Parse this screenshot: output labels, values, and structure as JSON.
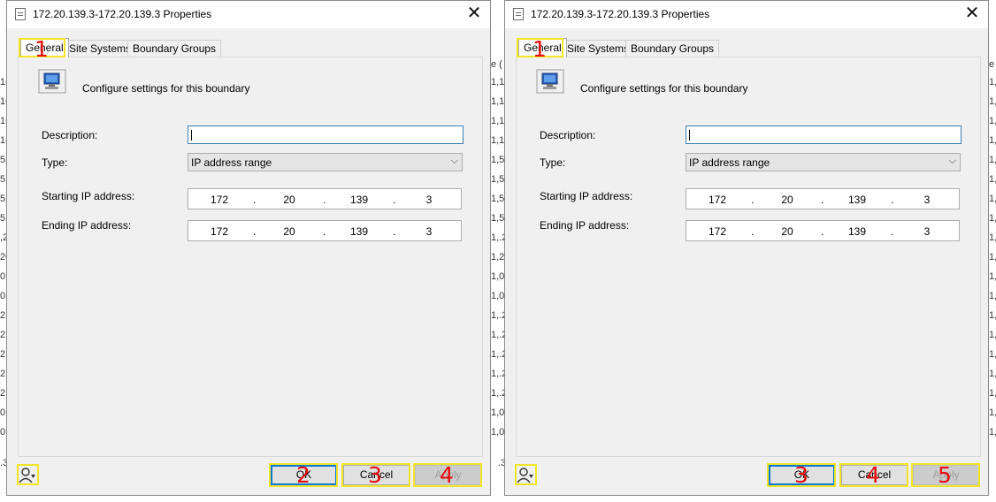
{
  "background": {
    "left_strip_chars": [
      "16",
      "16",
      "16",
      "16",
      "5.",
      "5.",
      "5.",
      "5.",
      ",2",
      "20",
      "0.",
      "0.",
      "2.",
      "2.",
      "2.",
      "2.",
      "2.",
      "0.",
      "0."
    ],
    "middle_strip_chars": [
      "1,16",
      "1,16",
      "1,16",
      "1,16",
      "1,5.",
      "1,5.",
      "1,5.",
      "1,5.",
      "1,.2",
      "1,20",
      "1,0.",
      "1,0.",
      "1,.2",
      "1,.2",
      "1,.2",
      "1,.2",
      "1,.2",
      "1,0.",
      "1,0."
    ],
    "middle_top_char": "e (",
    "right_top_char": "e (",
    "right_strip_chars": [
      "1,",
      "1,",
      "1,",
      "1,",
      "1,",
      "1,",
      "1,",
      "1,",
      "1,",
      "1,",
      "1,",
      "1,",
      "1,",
      "1,",
      "1,",
      "1,",
      "1,",
      "1,",
      "1,"
    ],
    "bottom_left_char": ".3",
    "bottom_mid_char": ".3"
  },
  "dialogs": [
    {
      "title": "172.20.139.3-172.20.139.3 Properties",
      "close_glyph": "✕",
      "tabs": [
        "General",
        "Site Systems",
        "Boundary Groups"
      ],
      "header_text": "Configure settings for this boundary",
      "labels": {
        "description": "Description:",
        "type": "Type:",
        "start_ip": "Starting IP address:",
        "end_ip": "Ending IP address:"
      },
      "description_value": "",
      "type_value": "IP address range",
      "start_ip": [
        "172",
        "20",
        "139",
        "3"
      ],
      "end_ip": [
        "172",
        "20",
        "139",
        "3"
      ],
      "buttons": {
        "ok": "OK",
        "cancel": "Cancel",
        "apply": "Apply"
      },
      "markers": {
        "tab_general": "1",
        "ok": "2",
        "cancel": "3",
        "apply": "4"
      }
    },
    {
      "title": "172.20.139.3-172.20.139.3 Properties",
      "close_glyph": "✕",
      "tabs": [
        "General",
        "Site Systems",
        "Boundary Groups"
      ],
      "header_text": "Configure settings for this boundary",
      "labels": {
        "description": "Description:",
        "type": "Type:",
        "start_ip": "Starting IP address:",
        "end_ip": "Ending IP address:"
      },
      "description_value": "",
      "type_value": "IP address range",
      "start_ip": [
        "172",
        "20",
        "139",
        "3"
      ],
      "end_ip": [
        "172",
        "20",
        "139",
        "3"
      ],
      "buttons": {
        "ok": "OK",
        "cancel": "Cancel",
        "apply": "Apply"
      },
      "markers": {
        "tab_general": "1",
        "ok": "3",
        "cancel": "4",
        "apply": "5"
      }
    }
  ],
  "colors": {
    "marker_box": "#f2e526",
    "marker_number": "#e60d0d",
    "focus_border": "#0078d7"
  }
}
